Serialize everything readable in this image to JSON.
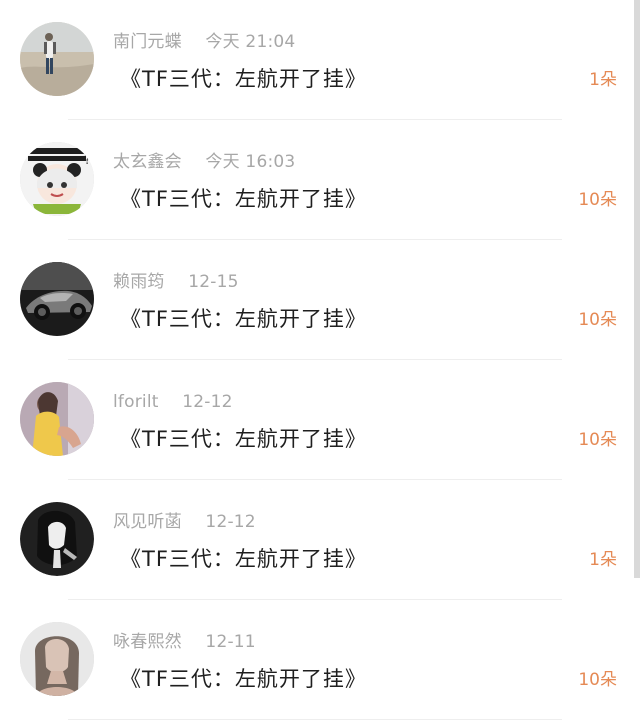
{
  "comments": [
    {
      "username": "南门元蝶",
      "time": "今天 21:04",
      "content": "《TF三代：左航开了挂》",
      "count": "1朵",
      "avatar_icon": "person-standing-avatar-icon"
    },
    {
      "username": "太玄鑫会",
      "time": "今天 16:03",
      "content": "《TF三代：左航开了挂》",
      "count": "10朵",
      "avatar_icon": "cartoon-child-avatar-icon"
    },
    {
      "username": "赖雨筠",
      "time": "12-15",
      "content": "《TF三代：左航开了挂》",
      "count": "10朵",
      "avatar_icon": "sports-car-avatar-icon"
    },
    {
      "username": "lforilt",
      "time": "12-12",
      "content": "《TF三代：左航开了挂》",
      "count": "10朵",
      "avatar_icon": "girl-portrait-avatar-icon"
    },
    {
      "username": "风见听菡",
      "time": "12-12",
      "content": "《TF三代：左航开了挂》",
      "count": "1朵",
      "avatar_icon": "dark-portrait-avatar-icon"
    },
    {
      "username": "咏春熙然",
      "time": "12-11",
      "content": "《TF三代：左航开了挂》",
      "count": "10朵",
      "avatar_icon": "woman-portrait-avatar-icon"
    }
  ],
  "colors": {
    "meta": "#a7a7a7",
    "content": "#1f1f1f",
    "count": "#e58a55",
    "divider": "#eeeeee",
    "background": "#ffffff"
  }
}
